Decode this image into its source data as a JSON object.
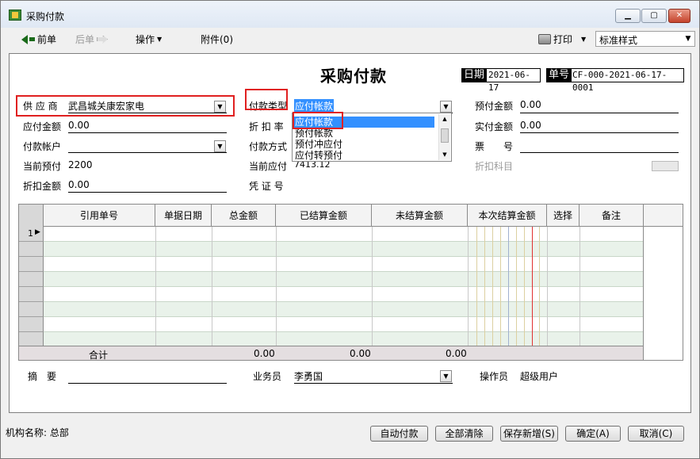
{
  "window": {
    "title": "采购付款",
    "min_label": "▁",
    "max_label": "▢",
    "close_label": "✕"
  },
  "toolbar": {
    "prev": "前单",
    "next": "后单",
    "ops": "操作",
    "attach": "附件(0)",
    "print": "打印",
    "style": "标准样式"
  },
  "doc": {
    "title": "采购付款",
    "date_label": "日期",
    "date_value": "2021-06-17",
    "no_label": "单号",
    "no_value": "CF-000-2021-06-17-0001"
  },
  "form": {
    "supplier_label": "供 应 商",
    "supplier_value": "武昌城关康宏家电",
    "payable_label": "应付金额",
    "payable_value": "0.00",
    "account_label": "付款帐户",
    "account_value": "",
    "prepay_cur_label": "当前预付",
    "prepay_cur_value": "2200",
    "discount_amt_label": "折扣金额",
    "discount_amt_value": "0.00",
    "paytype_label": "付款类型",
    "paytype_value": "应付帐款",
    "rate_label": "折 扣 率",
    "paymethod_label": "付款方式",
    "payable_cur_label": "当前应付",
    "payable_cur_value": "7413.12",
    "voucher_label": "凭 证 号",
    "prepay_amt_label": "预付金额",
    "prepay_amt_value": "0.00",
    "actual_label": "实付金额",
    "actual_value": "0.00",
    "ticket_label": "票　　号",
    "discount_subj_label": "折扣科目",
    "memo_label": "摘　要",
    "salesman_label": "业务员",
    "salesman_value": "李勇国",
    "operator_label": "操作员",
    "operator_value": "超级用户"
  },
  "dropdown": {
    "options": [
      "应付帐款",
      "预付帐款",
      "预付冲应付",
      "应付转预付"
    ]
  },
  "grid": {
    "headers": [
      "引用单号",
      "单据日期",
      "总金额",
      "已结算金额",
      "未结算金额",
      "本次结算金额",
      "选择",
      "备注"
    ],
    "row1": "1",
    "total_label": "合计",
    "total_amount": "0.00",
    "total_settled": "0.00",
    "total_unsettled": "0.00"
  },
  "status": {
    "org": "机构名称: 总部"
  },
  "buttons": {
    "auto": "自动付款",
    "clear": "全部清除",
    "save_new": "保存新增(S)",
    "ok": "确定(A)",
    "cancel": "取消(C)"
  },
  "colors": {
    "highlight_box": "#e02020",
    "selection": "#3390ff"
  }
}
